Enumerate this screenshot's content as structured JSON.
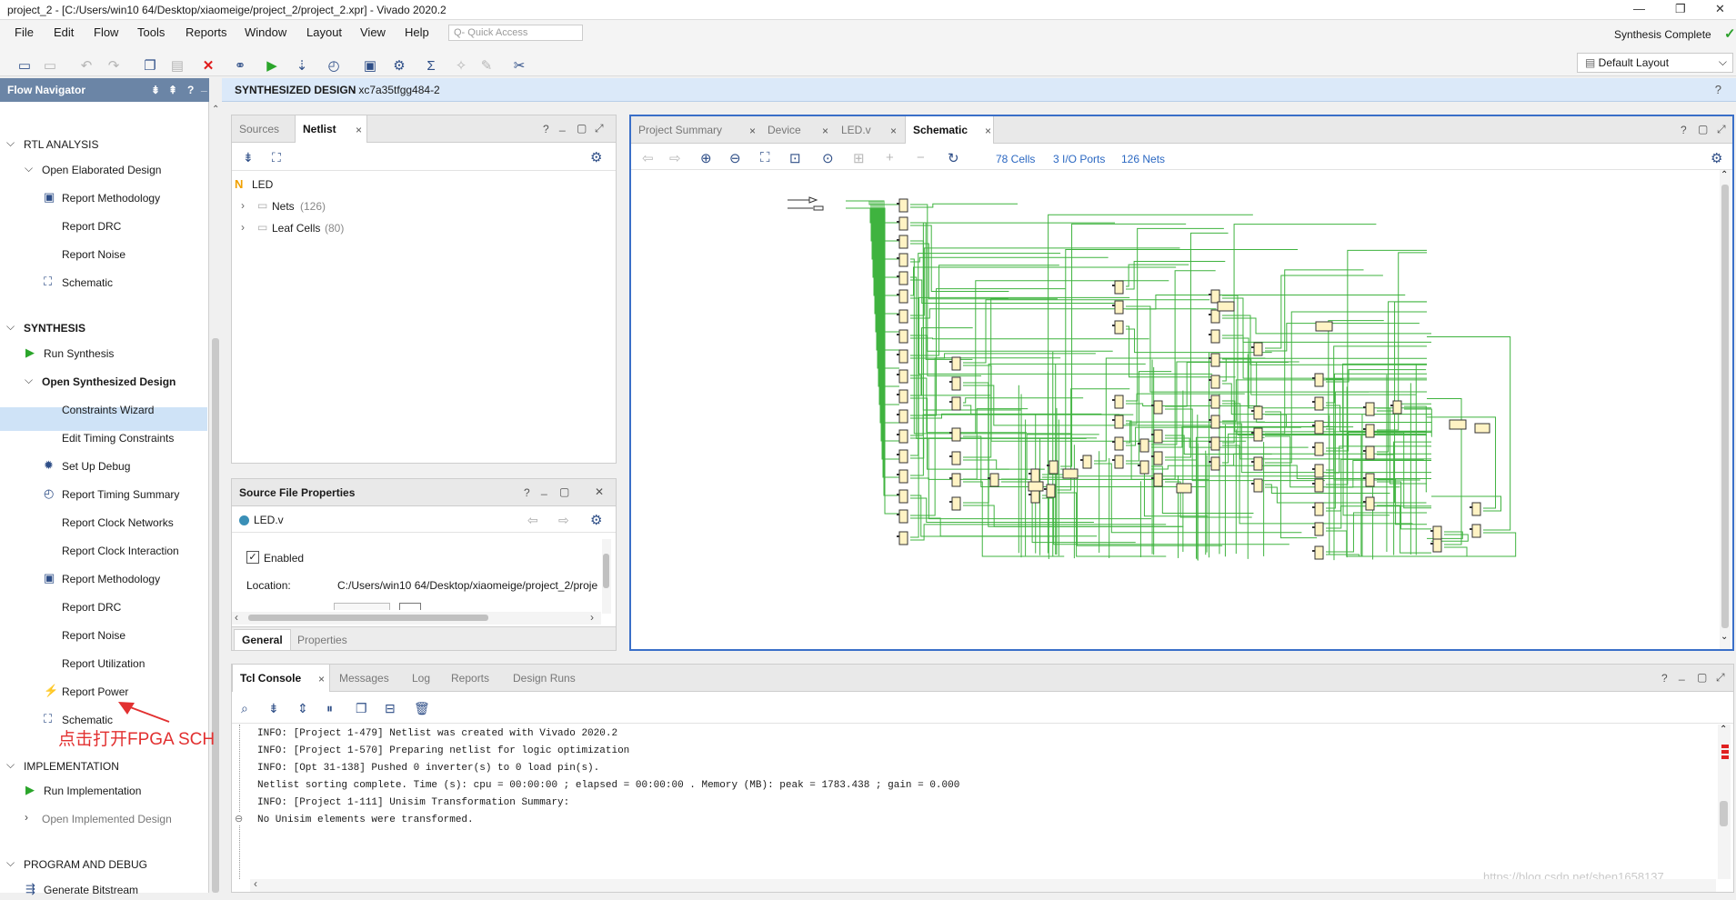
{
  "window": {
    "title": "project_2 - [C:/Users/win10 64/Desktop/xiaomeige/project_2/project_2.xpr] - Vivado 2020.2",
    "min_icon": "minimize-icon",
    "restore_icon": "restore-icon",
    "close_icon": "close-icon",
    "min_glyph": "—",
    "restore_glyph": "❐",
    "close_glyph": "✕"
  },
  "menu": [
    "File",
    "Edit",
    "Flow",
    "Tools",
    "Reports",
    "Window",
    "Layout",
    "View",
    "Help"
  ],
  "quick_access": {
    "placeholder": "Quick Access",
    "glyph": "Q-"
  },
  "status": {
    "text": "Synthesis Complete",
    "check_glyph": "✓"
  },
  "layout_select": {
    "value": "Default Layout",
    "arrow": "⌵"
  },
  "toolbar_icons": [
    {
      "name": "open-project-icon",
      "glyph": "▭"
    },
    {
      "name": "save-icon",
      "glyph": "▭"
    },
    {
      "name": "undo-icon",
      "glyph": "↶"
    },
    {
      "name": "redo-icon",
      "glyph": "↷"
    },
    {
      "name": "copy-icon",
      "glyph": "❐"
    },
    {
      "name": "paste-icon",
      "glyph": "▤"
    },
    {
      "name": "delete-icon",
      "glyph": "✕"
    },
    {
      "name": "binoculars-icon",
      "glyph": "⚭"
    },
    {
      "name": "run-icon",
      "glyph": "▶"
    },
    {
      "name": "program-icon",
      "glyph": "⇣"
    },
    {
      "name": "timer-icon",
      "glyph": "◴"
    },
    {
      "name": "report-icon",
      "glyph": "▣"
    },
    {
      "name": "settings-icon",
      "glyph": "⚙"
    },
    {
      "name": "sigma-icon",
      "glyph": "Σ"
    },
    {
      "name": "disabled-tool-icon",
      "glyph": "✧"
    },
    {
      "name": "pencil-icon",
      "glyph": "✎"
    },
    {
      "name": "cut-icon",
      "glyph": "✂"
    }
  ],
  "flow_nav": {
    "title": "Flow Navigator",
    "icons": {
      "collapse": "⇟",
      "expand": "⇞",
      "help": "?",
      "min": "_"
    },
    "rows": [
      {
        "key": "rtl",
        "label": "RTL ANALYSIS",
        "section": true,
        "arrow": "⌵"
      },
      {
        "key": "elab",
        "label": "Open Elaborated Design",
        "arrow": "⌵"
      },
      {
        "key": "rtl-method",
        "label": "Report Methodology",
        "icon": "▣"
      },
      {
        "key": "rtl-drc",
        "label": "Report DRC"
      },
      {
        "key": "rtl-noise",
        "label": "Report Noise"
      },
      {
        "key": "rtl-schem",
        "label": "Schematic",
        "icon": "⛶"
      },
      {
        "key": "synth",
        "label": "SYNTHESIS",
        "section": true,
        "arrow": "⌵"
      },
      {
        "key": "run-synth",
        "label": "Run Synthesis",
        "icon": "▶"
      },
      {
        "key": "open-synth",
        "label": "Open Synthesized Design",
        "arrow": "⌵"
      },
      {
        "key": "cons-wiz",
        "label": "Constraints Wizard"
      },
      {
        "key": "edit-timing",
        "label": "Edit Timing Constraints"
      },
      {
        "key": "setup-debug",
        "label": "Set Up Debug",
        "icon": "✹"
      },
      {
        "key": "timing-sum",
        "label": "Report Timing Summary",
        "icon": "◴"
      },
      {
        "key": "clk-net",
        "label": "Report Clock Networks"
      },
      {
        "key": "clk-int",
        "label": "Report Clock Interaction"
      },
      {
        "key": "syn-method",
        "label": "Report Methodology",
        "icon": "▣"
      },
      {
        "key": "syn-drc",
        "label": "Report DRC"
      },
      {
        "key": "syn-noise",
        "label": "Report Noise"
      },
      {
        "key": "util",
        "label": "Report Utilization"
      },
      {
        "key": "power",
        "label": "Report Power",
        "icon": "⚡"
      },
      {
        "key": "syn-schem",
        "label": "Schematic",
        "icon": "⛶"
      },
      {
        "key": "impl",
        "label": "IMPLEMENTATION",
        "section": true,
        "arrow": "⌵"
      },
      {
        "key": "run-impl",
        "label": "Run Implementation",
        "icon": "▶"
      },
      {
        "key": "open-impl",
        "label": "Open Implemented Design",
        "arrow": "›"
      },
      {
        "key": "prog",
        "label": "PROGRAM AND DEBUG",
        "section": true,
        "arrow": "⌵"
      },
      {
        "key": "bitstream",
        "label": "Generate Bitstream",
        "icon": "⇶"
      }
    ]
  },
  "annotation": {
    "text": "点击打开FPGA SCH",
    "arrow": "➤"
  },
  "synth_header": {
    "title": "SYNTHESIZED DESIGN",
    "part": " - xc7a35tfgg484-2",
    "help": "?"
  },
  "netlist": {
    "tabs": [
      "Sources",
      "Netlist"
    ],
    "close": "×",
    "controls": [
      "?",
      "_",
      "▢",
      "⤢"
    ],
    "collapse_glyph": "⇟",
    "hier_glyph": "⛶",
    "gear": "⚙",
    "root_icon": "N",
    "root": "LED",
    "tree_arrow": "›",
    "folder_glyph": "▭",
    "items": [
      {
        "label": "Nets",
        "count": "(126)"
      },
      {
        "label": "Leaf Cells",
        "count": "(80)"
      }
    ]
  },
  "source_props": {
    "title": "Source File Properties",
    "controls": [
      "?",
      "_",
      "▢",
      "✕"
    ],
    "file": "LED.v",
    "back": "⇦",
    "fwd": "⇨",
    "gear": "⚙",
    "enabled": "Enabled",
    "check": "✓",
    "location_label": "Location:",
    "location_value": "C:/Users/win10 64/Desktop/xiaomeige/project_2/proje",
    "scroll_left": "‹",
    "scroll_right": "›",
    "tabs": [
      "General",
      "Properties"
    ]
  },
  "editor": {
    "tabs": [
      "Project Summary",
      "Device",
      "LED.v",
      "Schematic"
    ],
    "close": "×",
    "controls": [
      "?",
      "▢",
      "⤢"
    ],
    "tool_icons": [
      {
        "name": "back-icon",
        "glyph": "⇦"
      },
      {
        "name": "forward-icon",
        "glyph": "⇨"
      },
      {
        "name": "zoom-in-icon",
        "glyph": "⊕"
      },
      {
        "name": "zoom-out-icon",
        "glyph": "⊖"
      },
      {
        "name": "fit-icon",
        "glyph": "⛶"
      },
      {
        "name": "zoom-area-icon",
        "glyph": "⊡"
      },
      {
        "name": "crosshair-icon",
        "glyph": "⊙"
      },
      {
        "name": "mark-icon",
        "glyph": "⊞"
      },
      {
        "name": "expand-icon",
        "glyph": "+"
      },
      {
        "name": "collapse-icon",
        "glyph": "−"
      },
      {
        "name": "refresh-icon",
        "glyph": "↻"
      }
    ],
    "stats": [
      "78 Cells",
      "3 I/O Ports",
      "126 Nets"
    ],
    "gear": "⚙",
    "scroll_up": "⌃",
    "scroll_down": "⌄"
  },
  "console": {
    "tabs": [
      "Tcl Console",
      "Messages",
      "Log",
      "Reports",
      "Design Runs"
    ],
    "close": "×",
    "controls": [
      "?",
      "_",
      "▢",
      "⤢"
    ],
    "tool_icons": [
      {
        "name": "search-icon",
        "glyph": "⌕"
      },
      {
        "name": "collapse-all-icon",
        "glyph": "⇟"
      },
      {
        "name": "expand-all-icon",
        "glyph": "⇕"
      },
      {
        "name": "pause-icon",
        "glyph": "⏸"
      },
      {
        "name": "copy-icon",
        "glyph": "❐"
      },
      {
        "name": "columns-icon",
        "glyph": "⊟"
      },
      {
        "name": "trash-icon",
        "glyph": "🗑"
      }
    ],
    "lines": [
      "INFO: [Project 1-479] Netlist was created with Vivado 2020.2",
      "INFO: [Project 1-570] Preparing netlist for logic optimization",
      "INFO: [Opt 31-138] Pushed 0 inverter(s) to 0 load pin(s).",
      "Netlist sorting complete. Time (s): cpu = 00:00:00 ; elapsed = 00:00:00 . Memory (MB): peak = 1783.438 ; gain = 0.000",
      "INFO: [Project 1-111] Unisim Transformation Summary:",
      "No Unisim elements were transformed."
    ],
    "fold_glyph": "⊖",
    "watermark": "https://blog.csdn.net/shen1658137"
  },
  "colors": {
    "wire": "#3fb33f",
    "accent": "#3a6fc8",
    "brand_header": "#6b85a6",
    "selection": "#cfe3f7",
    "annotation": "#e23030"
  }
}
